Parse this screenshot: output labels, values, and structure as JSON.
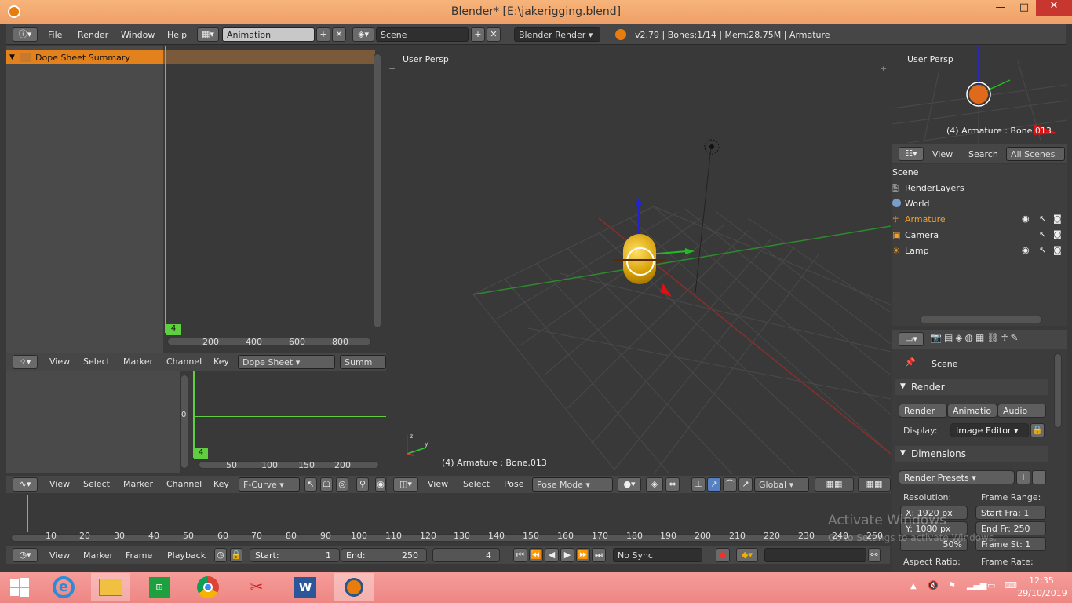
{
  "window": {
    "title": "Blender* [E:\\jakerigging.blend]",
    "min": "—",
    "max": "□",
    "close": "✕"
  },
  "infobar": {
    "menus": [
      "File",
      "Render",
      "Window",
      "Help"
    ],
    "layout": "Animation",
    "scene": "Scene",
    "engine": "Blender Render",
    "stats": "v2.79 | Bones:1/14  | Mem:28.75M | Armature"
  },
  "dopesheet_top": {
    "channel": "Dope Sheet Summary",
    "frame": "4",
    "ticks": [
      "200",
      "400",
      "600",
      "800"
    ],
    "header_menus": [
      "View",
      "Select",
      "Marker",
      "Channel",
      "Key"
    ],
    "mode": "Dope Sheet",
    "summary": "Summ"
  },
  "fcurve": {
    "frame": "4",
    "yval": "0",
    "ticks": [
      "50",
      "100",
      "150",
      "200"
    ],
    "header_menus": [
      "View",
      "Select",
      "Marker",
      "Channel",
      "Key"
    ],
    "mode": "F-Curve"
  },
  "viewport3d": {
    "label": "User Persp",
    "object_info": "(4) Armature : Bone.013",
    "header_menus": [
      "View",
      "Select",
      "Pose"
    ],
    "mode": "Pose Mode",
    "orientation": "Global"
  },
  "minimap": {
    "label": "User Persp",
    "object_info": "(4) Armature : Bone.013"
  },
  "outliner": {
    "header_menus": [
      "View",
      "Search"
    ],
    "filter": "All Scenes",
    "root": "Scene",
    "items": [
      "RenderLayers",
      "World",
      "Armature",
      "Camera",
      "Lamp"
    ]
  },
  "properties": {
    "context": "Scene",
    "render_panel": "Render",
    "render_buttons": [
      "Render",
      "Animatio",
      "Audio"
    ],
    "display_label": "Display:",
    "display_value": "Image Editor",
    "dimensions_panel": "Dimensions",
    "presets": "Render Presets",
    "resolution_label": "Resolution:",
    "frame_range_label": "Frame Range:",
    "res_x": "X: 1920 px",
    "res_y": "Y: 1080 px",
    "res_pct": "50%",
    "start_fra": "Start Fra:  1",
    "end_fr": "End Fr: 250",
    "frame_st": "Frame St:  1",
    "aspect_label": "Aspect Ratio:",
    "frame_rate_label": "Frame Rate:"
  },
  "timeline": {
    "ticks": [
      "10",
      "20",
      "30",
      "40",
      "50",
      "60",
      "70",
      "80",
      "90",
      "100",
      "110",
      "120",
      "130",
      "140",
      "150",
      "160",
      "170",
      "180",
      "190",
      "200",
      "210",
      "220",
      "230",
      "240",
      "250"
    ],
    "header_menus": [
      "View",
      "Marker",
      "Frame",
      "Playback"
    ],
    "start": "Start:",
    "start_val": "1",
    "end": "End:",
    "end_val": "250",
    "current": "4",
    "sync": "No Sync"
  },
  "watermark": {
    "line1": "Activate Windows",
    "line2": "Go to Settings to activate Windows."
  },
  "taskbar": {
    "time": "12:35",
    "date": "29/10/2019"
  }
}
